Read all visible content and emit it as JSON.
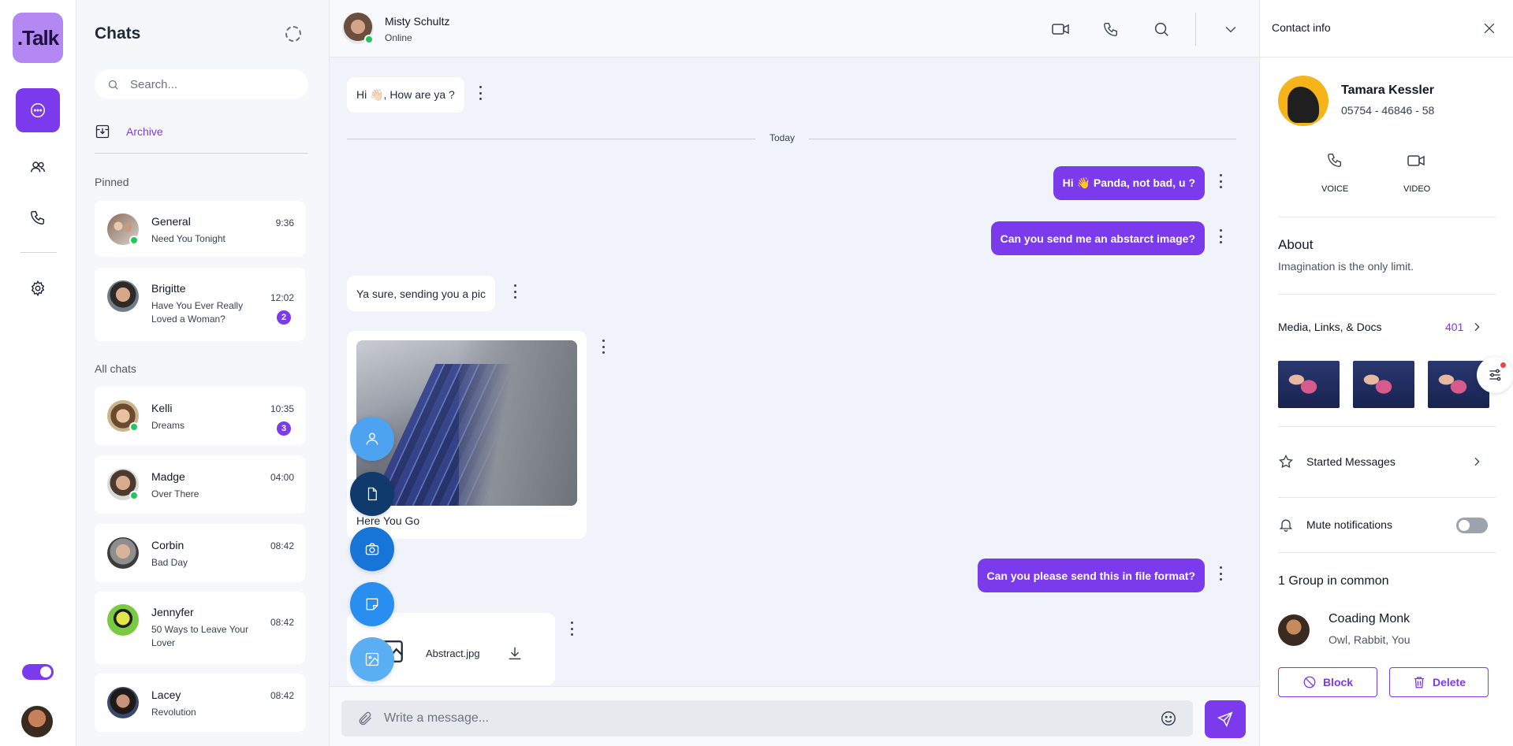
{
  "app": {
    "logo_text": ".Talk",
    "accent": "#7c3aed"
  },
  "rail": {
    "items": [
      "chat-icon",
      "users-icon",
      "phone-icon",
      "gear-icon"
    ]
  },
  "chat_list": {
    "title": "Chats",
    "search_placeholder": "Search...",
    "archive_label": "Archive",
    "pinned_label": "Pinned",
    "all_label": "All chats",
    "pinned": [
      {
        "name": "General",
        "message": "Need You Tonight",
        "time": "9:36",
        "online": true,
        "badge": ""
      },
      {
        "name": "Brigitte",
        "message": "Have You Ever Really Loved a Woman?",
        "time": "12:02",
        "online": false,
        "badge": "2"
      }
    ],
    "all": [
      {
        "name": "Kelli",
        "message": "Dreams",
        "time": "10:35",
        "online": true,
        "badge": "3"
      },
      {
        "name": "Madge",
        "message": "Over There",
        "time": "04:00",
        "online": true,
        "badge": ""
      },
      {
        "name": "Corbin",
        "message": "Bad Day",
        "time": "08:42",
        "online": false,
        "badge": ""
      },
      {
        "name": "Jennyfer",
        "message": "50 Ways to Leave Your Lover",
        "time": "08:42",
        "online": false,
        "badge": ""
      },
      {
        "name": "Lacey",
        "message": "Revolution",
        "time": "08:42",
        "online": false,
        "badge": ""
      }
    ]
  },
  "conversation": {
    "contact_name": "Misty Schultz",
    "contact_status": "Online",
    "day_divider": "Today",
    "messages": [
      {
        "direction": "in",
        "text": "Hi 👋🏻, How are ya ?"
      },
      {
        "direction": "out",
        "text": "Hi 👋 Panda, not bad, u ?"
      },
      {
        "direction": "out",
        "text": "Can you send me an abstarct image?"
      },
      {
        "direction": "in",
        "text": "Ya sure, sending you a pic"
      },
      {
        "direction": "in",
        "text": "Here You Go"
      },
      {
        "direction": "out",
        "text": "Can you please send this in file format?"
      },
      {
        "direction": "in",
        "text": "Abstract.jpg"
      }
    ],
    "composer_placeholder": "Write a message..."
  },
  "contact_info": {
    "title": "Contact info",
    "name": "Tamara Kessler",
    "phone": "05754 - 46846 - 58",
    "voice_label": "VOICE",
    "video_label": "VIDEO",
    "about_title": "About",
    "about_text": "Imagination is the only limit.",
    "media_label": "Media, Links, & Docs",
    "media_count": "401",
    "starred_label": "Started Messages",
    "mute_label": "Mute notifications",
    "mute_on": false,
    "group_title": "1 Group in common",
    "group_name": "Coading Monk",
    "group_members": "Owl, Rabbit, You",
    "block_label": "Block",
    "delete_label": "Delete"
  }
}
